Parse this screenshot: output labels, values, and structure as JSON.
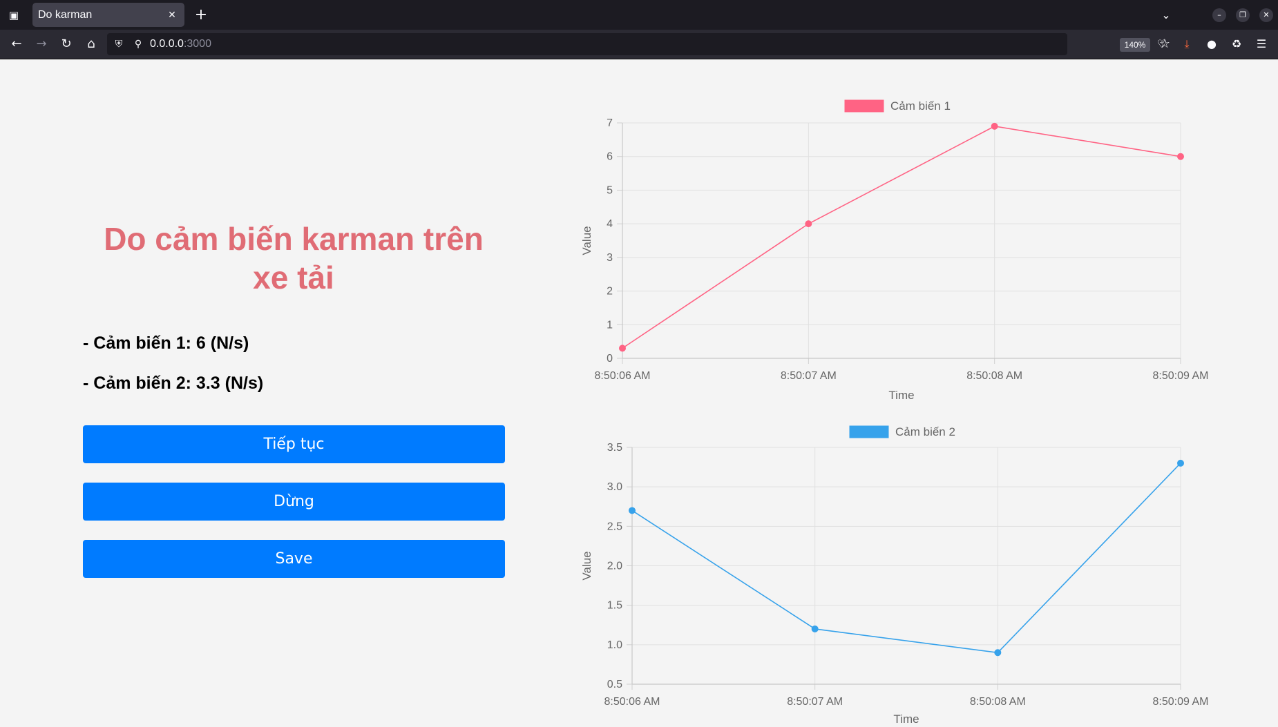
{
  "browser": {
    "tab_title": "Do karman",
    "url_host": "0.0.0.0",
    "url_port": ":3000",
    "zoom": "140%"
  },
  "page": {
    "heading": "Do cảm biến karman trên xe tải",
    "sensor1_reading": "- Cảm biến 1: 6 (N/s)",
    "sensor2_reading": "- Cảm biến 2: 3.3 (N/s)",
    "buttons": {
      "continue": "Tiếp tục",
      "stop": "Dừng",
      "save": "Save"
    }
  },
  "chart_data": [
    {
      "type": "line",
      "x": [
        "8:50:06 AM",
        "8:50:07 AM",
        "8:50:08 AM",
        "8:50:09 AM"
      ],
      "series": [
        {
          "name": "Cảm biến 1",
          "values": [
            0.3,
            4,
            6.9,
            6
          ],
          "color": "#ff6384"
        }
      ],
      "xlabel": "Time",
      "ylabel": "Value",
      "ylim": [
        0,
        7
      ],
      "yticks": [
        "0",
        "1",
        "2",
        "3",
        "4",
        "5",
        "6",
        "7"
      ],
      "grid": true,
      "legend": "top"
    },
    {
      "type": "line",
      "x": [
        "8:50:06 AM",
        "8:50:07 AM",
        "8:50:08 AM",
        "8:50:09 AM"
      ],
      "series": [
        {
          "name": "Cảm biến 2",
          "values": [
            2.7,
            1.2,
            0.9,
            3.3
          ],
          "color": "#36a2eb"
        }
      ],
      "xlabel": "Time",
      "ylabel": "Value",
      "ylim": [
        0.5,
        3.5
      ],
      "yticks": [
        "0.5",
        "1.0",
        "1.5",
        "2.0",
        "2.5",
        "3.0",
        "3.5"
      ],
      "grid": true,
      "legend": "top"
    }
  ]
}
